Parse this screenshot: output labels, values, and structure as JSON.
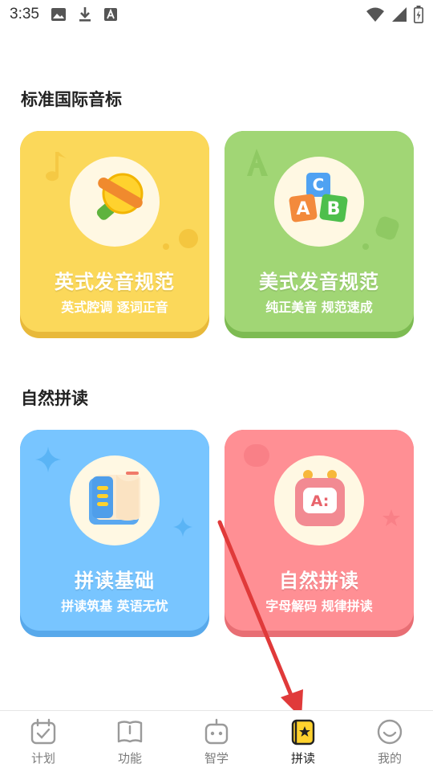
{
  "status_bar": {
    "time": "3:35",
    "left_icons": [
      "image-icon",
      "download-icon",
      "font-icon"
    ],
    "right_icons": [
      "wifi-icon",
      "signal-icon",
      "battery-icon"
    ]
  },
  "sections": [
    {
      "title": "标准国际音标",
      "cards": [
        {
          "title": "英式发音规范",
          "subtitle": "英式腔调 逐词正音",
          "color": "#FBD85A",
          "icon": "whistle-icon"
        },
        {
          "title": "美式发音规范",
          "subtitle": "纯正美音 规范速成",
          "color": "#A1D675",
          "icon": "abc-blocks-icon"
        }
      ]
    },
    {
      "title": "自然拼读",
      "cards": [
        {
          "title": "拼读基础",
          "subtitle": "拼读筑基 英语无忧",
          "color": "#78C5FF",
          "icon": "book-icon"
        },
        {
          "title": "自然拼读",
          "subtitle": "字母解码 规律拼读",
          "color": "#FF8F94",
          "icon": "alarm-clock-icon"
        }
      ]
    }
  ],
  "annotation": {
    "arrow_color": "#E03A3A"
  },
  "bottom_nav": {
    "items": [
      {
        "label": "计划",
        "icon": "calendar-check-icon",
        "active": false
      },
      {
        "label": "功能",
        "icon": "open-book-icon",
        "active": false
      },
      {
        "label": "智学",
        "icon": "robot-icon",
        "active": false
      },
      {
        "label": "拼读",
        "icon": "star-book-icon",
        "active": true
      },
      {
        "label": "我的",
        "icon": "smile-face-icon",
        "active": false
      }
    ]
  }
}
